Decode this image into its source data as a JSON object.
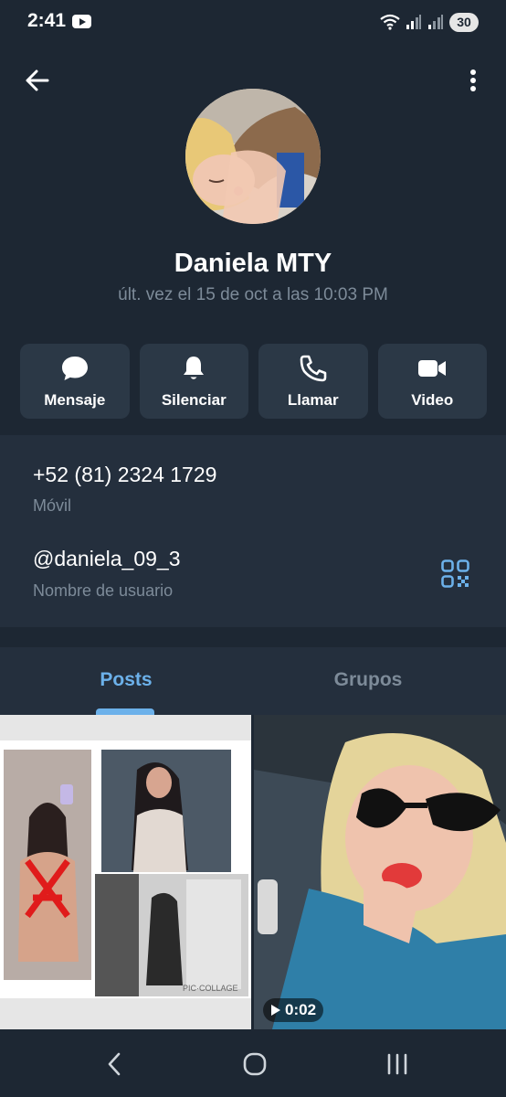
{
  "status_bar": {
    "time": "2:41",
    "battery": "30",
    "colors": {
      "background": "#1d2733"
    }
  },
  "header": {
    "back_icon": "arrow-left-icon",
    "more_icon": "more-vertical-icon",
    "avatar": "profile-photo",
    "name": "Daniela MTY",
    "last_seen": "últ. vez el 15 de oct a las 10:03 PM"
  },
  "actions": [
    {
      "label": "Mensaje",
      "icon": "chat-bubble-icon"
    },
    {
      "label": "Silenciar",
      "icon": "bell-icon"
    },
    {
      "label": "Llamar",
      "icon": "phone-icon"
    },
    {
      "label": "Video",
      "icon": "video-camera-icon"
    }
  ],
  "info": {
    "phone": "+52 (81) 2324 1729",
    "phone_label": "Móvil",
    "username": "@daniela_09_3",
    "username_label": "Nombre de usuario",
    "qr_icon": "qr-code-icon"
  },
  "tabs": [
    {
      "label": "Posts",
      "active": true
    },
    {
      "label": "Grupos",
      "active": false
    }
  ],
  "posts": [
    {
      "type": "photo-collage",
      "watermark": "PIC·COLLAGE"
    },
    {
      "type": "video",
      "duration": "0:02"
    }
  ],
  "colors": {
    "accent": "#6cb1ea",
    "muted_text": "#7d8b99",
    "card": "#2b3846",
    "panel": "#242f3d"
  }
}
